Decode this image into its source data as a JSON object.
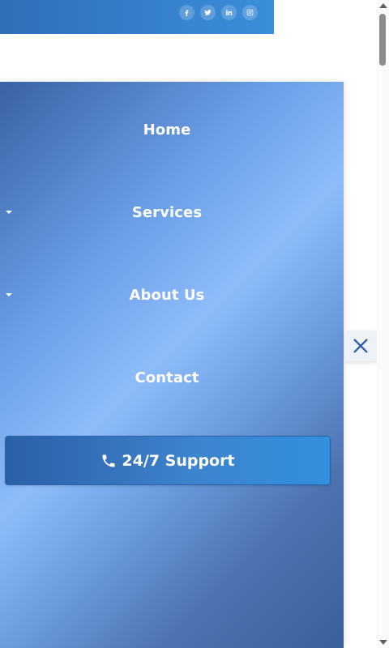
{
  "header": {
    "social": [
      {
        "icon": "facebook-icon",
        "label": "f"
      },
      {
        "icon": "twitter-icon",
        "label": "twitter"
      },
      {
        "icon": "linkedin-icon",
        "label": "in"
      },
      {
        "icon": "instagram-icon",
        "label": "instagram"
      }
    ]
  },
  "menu": {
    "items": [
      {
        "label": "Home",
        "has_submenu": false
      },
      {
        "label": "Services",
        "has_submenu": true
      },
      {
        "label": "About Us",
        "has_submenu": true
      },
      {
        "label": "Contact",
        "has_submenu": false
      }
    ],
    "support_button": {
      "label": "24/7 Support",
      "icon": "phone-icon"
    },
    "close_icon": "close-icon"
  },
  "colors": {
    "header_blue": "#2f6fb8",
    "menu_gradient_light": "#8ebcfb",
    "menu_gradient_dark": "#3a62a5",
    "button_blue": "#2c5fa6",
    "close_icon_color": "#2f5ea8"
  }
}
